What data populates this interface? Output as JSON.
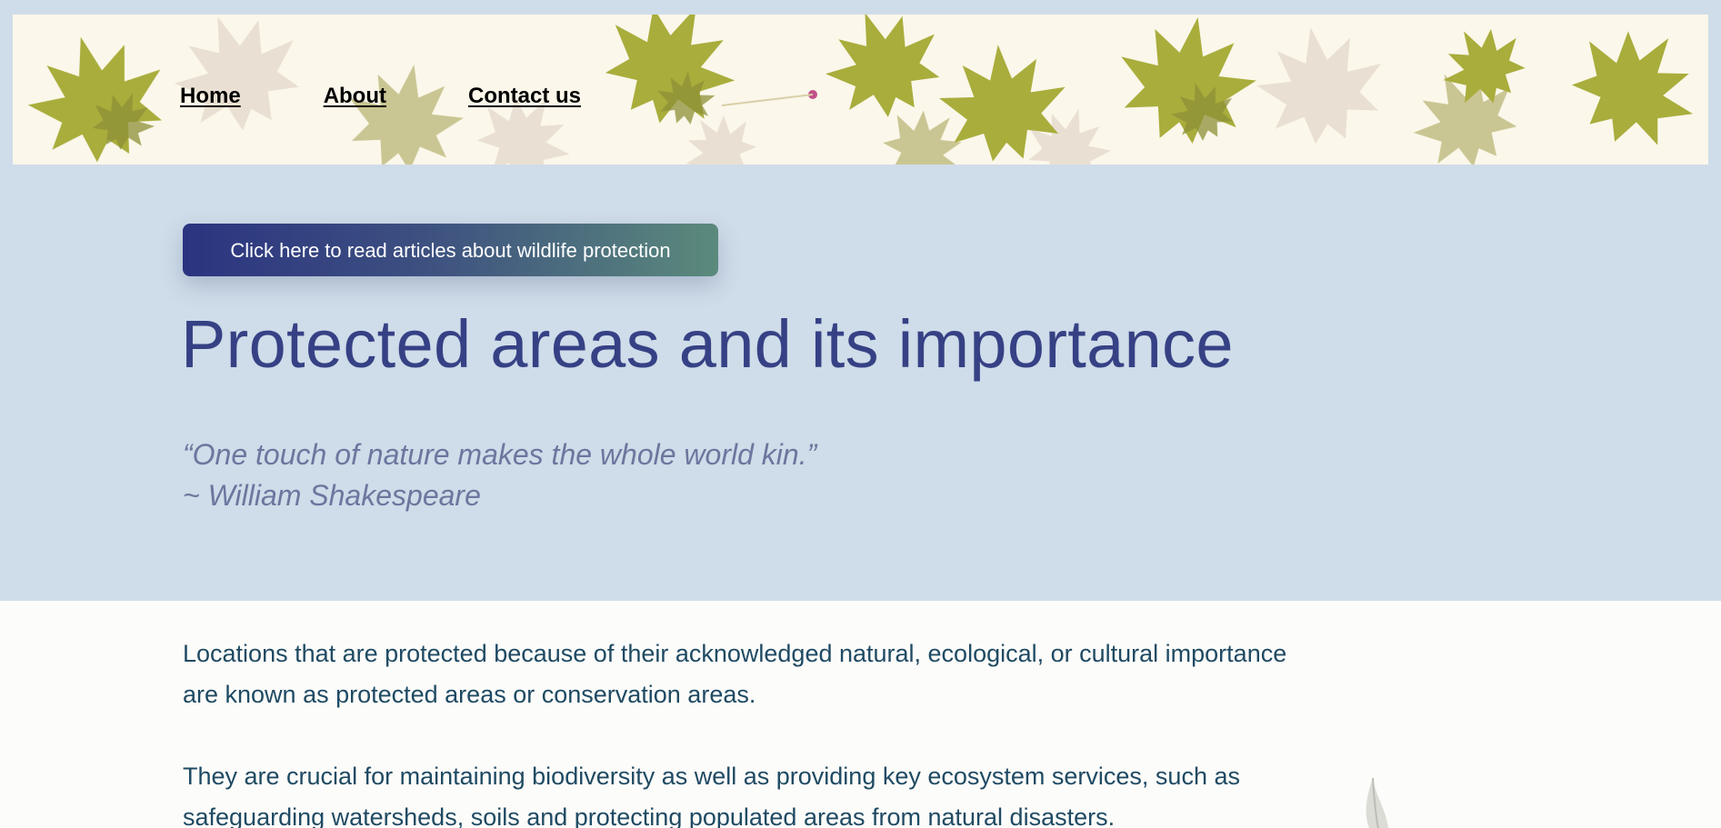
{
  "nav": {
    "items": [
      {
        "label": "Home"
      },
      {
        "label": "About"
      },
      {
        "label": "Contact us"
      }
    ]
  },
  "hero": {
    "cta_label": "Click here to read articles about wildlife protection",
    "title": "Protected areas and its importance",
    "quote_text": "“One touch of nature makes the whole world kin.”",
    "quote_author": "~ William Shakespeare"
  },
  "content": {
    "paragraphs": [
      "Locations that are protected because of their acknowledged natural, ecological, or cultural importance are known as protected areas or conservation areas.",
      "They are crucial for maintaining biodiversity as well as providing key ecosystem services, such as safeguarding watersheds, soils and protecting populated areas from natural disasters."
    ]
  },
  "colors": {
    "page_background": "#cfdce9",
    "title": "#364185",
    "quote": "#6b779e",
    "body_text": "#1f4a63",
    "content_background": "#fcfcfa",
    "cta_gradient_start": "#2b3480",
    "cta_gradient_end": "#5b8a7c"
  },
  "icons": {
    "banner_image": "maple-leaves-banner",
    "corner_decoration": "leaf-icon"
  }
}
